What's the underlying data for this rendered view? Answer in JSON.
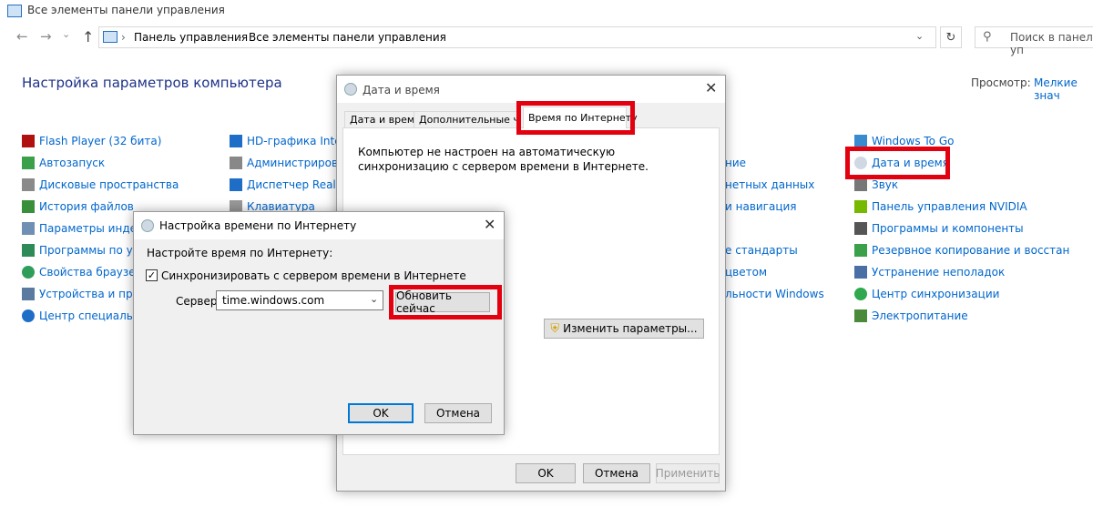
{
  "window": {
    "title": "Все элементы панели управления"
  },
  "address": {
    "crumbs": [
      "Панель управления",
      "Все элементы панели управления"
    ],
    "search_placeholder": "Поиск в панели уп"
  },
  "page": {
    "heading": "Настройка параметров компьютера",
    "view_label": "Просмотр:",
    "view_value": "Мелкие знач"
  },
  "items": {
    "col1": [
      "Flash Player (32 бита)",
      "Автозапуск",
      "Дисковые пространства",
      "История файлов",
      "Параметры индекса",
      "Программы по умо",
      "Свойства браузера",
      "Устройства и принт",
      "Центр специальных"
    ],
    "col2": [
      "HD-графика Intel®",
      "Администрирован",
      "Диспетчер Realtek",
      "Клавиатура"
    ],
    "col3": [
      "ние",
      "нетных данных",
      "и навигация",
      "е стандарты",
      "цветом",
      "льности Windows"
    ],
    "col4": [
      "Windows To Go",
      "Дата и время",
      "Звук",
      "Панель управления NVIDIA",
      "Программы и компоненты",
      "Резервное копирование и восстан",
      "Устранение неполадок",
      "Центр синхронизации",
      "Электропитание"
    ]
  },
  "datetime_dialog": {
    "title": "Дата и время",
    "tabs": [
      "Дата и время",
      "Дополнительные часы",
      "Время по Интернету"
    ],
    "message": "Компьютер не настроен на автоматическую синхронизацию с сервером времени в Интернете.",
    "change_button": "Изменить параметры...",
    "ok": "OK",
    "cancel": "Отмена",
    "apply": "Применить"
  },
  "inet_dialog": {
    "title": "Настройка времени по Интернету",
    "subtitle": "Настройте время по Интернету:",
    "sync_label": "Синхронизировать с сервером времени в Интернете",
    "sync_checked": true,
    "server_label": "Сервер:",
    "server_value": "time.windows.com",
    "update_button": "Обновить сейчас",
    "ok": "OK",
    "cancel": "Отмена"
  },
  "colors": {
    "highlight": "#e3000f",
    "link": "#0066cc"
  }
}
